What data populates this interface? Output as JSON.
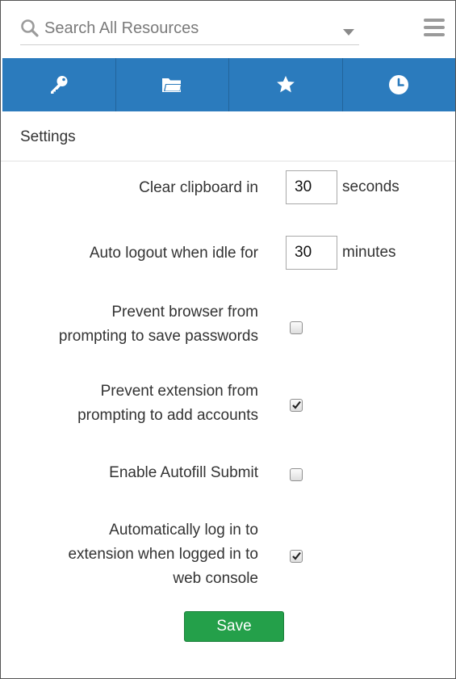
{
  "search": {
    "placeholder": "Search All Resources"
  },
  "icons": {
    "search": "search-icon",
    "dropdown": "caret-down-icon",
    "menu": "hamburger-menu-icon",
    "tabs": [
      "key-icon",
      "folder-icon",
      "star-icon",
      "clock-icon"
    ]
  },
  "colors": {
    "tabbar": "#2b7bbd",
    "save_button": "#24a04a"
  },
  "settings": {
    "title": "Settings",
    "clear_clipboard": {
      "label": "Clear clipboard in",
      "value": "30",
      "unit": "seconds"
    },
    "auto_logout": {
      "label": "Auto logout when idle for",
      "value": "30",
      "unit": "minutes"
    },
    "prevent_browser_save": {
      "label_line1": "Prevent browser from",
      "label_line2": "prompting to save passwords",
      "checked": false
    },
    "prevent_extension_add": {
      "label_line1": "Prevent extension from",
      "label_line2": "prompting to add accounts",
      "checked": true
    },
    "autofill_submit": {
      "label": "Enable Autofill Submit",
      "checked": false
    },
    "auto_login": {
      "label_line1": "Automatically log in to",
      "label_line2": "extension when logged in to",
      "label_line3": "web console",
      "checked": true
    },
    "save_label": "Save"
  }
}
